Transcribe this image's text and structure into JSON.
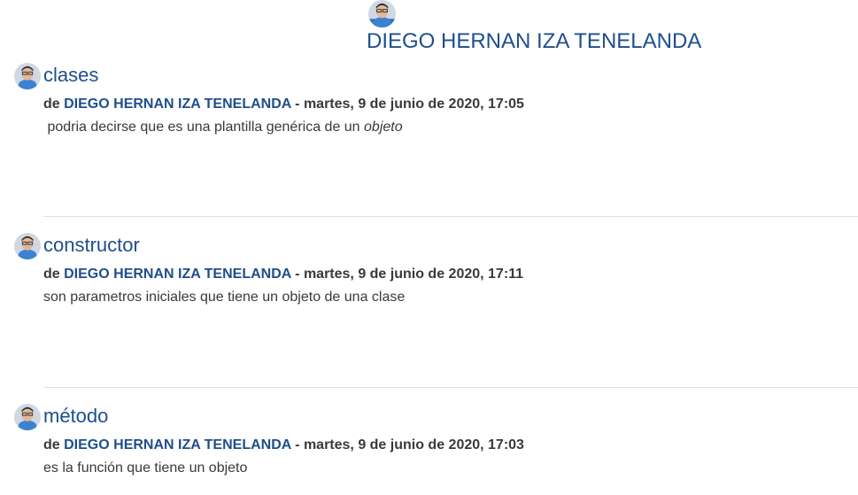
{
  "header": {
    "user_name": "DIEGO HERNAN IZA TENELANDA"
  },
  "entries": [
    {
      "title": "clases",
      "by_prefix": "de",
      "author": "DIEGO HERNAN IZA TENELANDA",
      "date": "- martes, 9 de junio de 2020, 17:05",
      "body_text": " podria decirse que es una plantilla genérica de un ",
      "body_emphasis": "objeto"
    },
    {
      "title": "constructor",
      "by_prefix": "de",
      "author": "DIEGO HERNAN IZA TENELANDA",
      "date": "- martes, 9 de junio de 2020, 17:11",
      "body_text": "son parametros iniciales que tiene un objeto de una clase"
    },
    {
      "title": "método",
      "by_prefix": "de",
      "author": "DIEGO HERNAN IZA TENELANDA",
      "date": "- martes, 9 de junio de 2020, 17:03",
      "body_text": "es la función que tiene un objeto"
    }
  ],
  "colors": {
    "link": "#1f4e8c",
    "text": "#373a3c",
    "divider": "#dee2e6"
  },
  "icons": {
    "avatar": "user-avatar-icon"
  }
}
